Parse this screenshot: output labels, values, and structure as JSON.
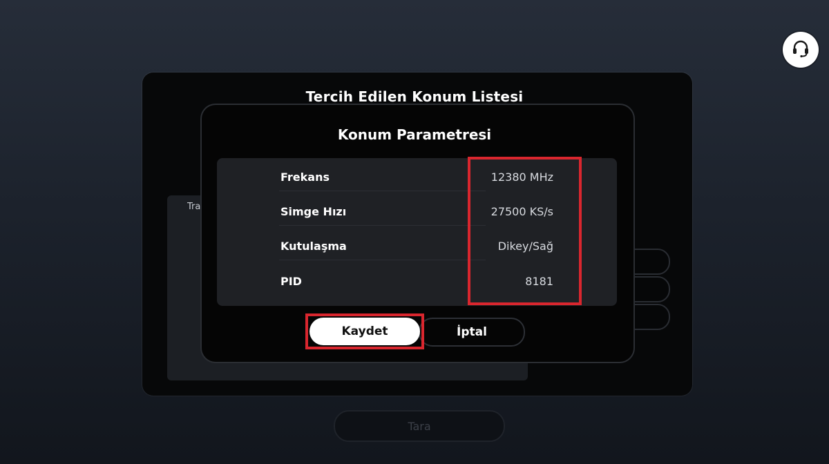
{
  "support": {
    "icon": "headset-icon"
  },
  "background_panel": {
    "title": "Tercih Edilen Konum Listesi",
    "subpanel_label": "Tra"
  },
  "scan_button": {
    "label": "Tara"
  },
  "dialog": {
    "title": "Konum Parametresi",
    "parameters": [
      {
        "label": "Frekans",
        "value": "12380 MHz"
      },
      {
        "label": "Simge Hızı",
        "value": "27500 KS/s"
      },
      {
        "label": "Kutulaşma",
        "value": "Dikey/Sağ"
      },
      {
        "label": "PID",
        "value": "8181"
      }
    ],
    "save_label": "Kaydet",
    "cancel_label": "İptal"
  },
  "colors": {
    "highlight": "#d9262e",
    "dialog_background": "#050505",
    "param_box_background": "#1f2125"
  }
}
